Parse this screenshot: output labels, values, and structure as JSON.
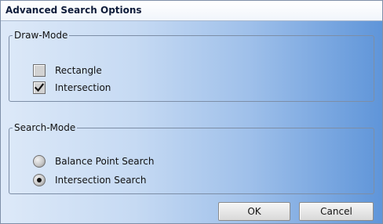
{
  "dialog": {
    "title": "Advanced Search Options"
  },
  "draw_mode": {
    "legend": "Draw-Mode",
    "options": [
      {
        "label": "Rectangle",
        "checked": false
      },
      {
        "label": "Intersection",
        "checked": true
      }
    ]
  },
  "search_mode": {
    "legend": "Search-Mode",
    "options": [
      {
        "label": "Balance Point Search",
        "selected": false
      },
      {
        "label": "Intersection Search",
        "selected": true
      }
    ]
  },
  "buttons": {
    "ok": "OK",
    "cancel": "Cancel"
  },
  "colors": {
    "gradient_light": "#dde9f8",
    "gradient_dark": "#5f95d9"
  }
}
